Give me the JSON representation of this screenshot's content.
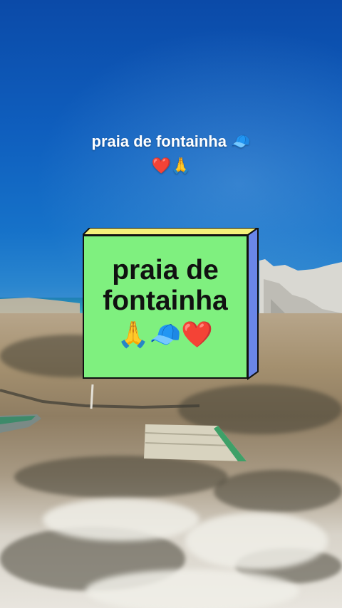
{
  "caption": {
    "line1": "praia de fontainha 🧢",
    "line2": "❤️🙏"
  },
  "sticker": {
    "line1": "praia de",
    "line2": "fontainha",
    "emojis": "🙏🧢❤️",
    "colors": {
      "face": "#7ff07f",
      "top": "#f5f07a",
      "side": "#6a86e8",
      "border": "#111111"
    }
  }
}
